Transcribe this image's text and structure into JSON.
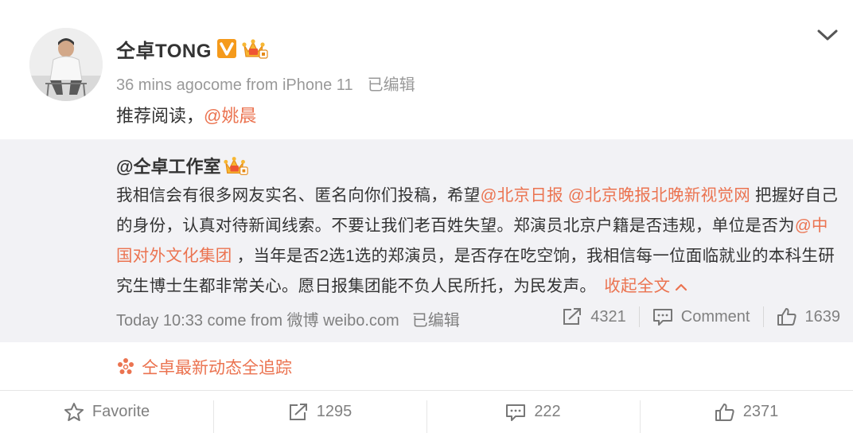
{
  "post": {
    "username": "仝卓TONG",
    "meta": {
      "time_source": "36 mins agocome from iPhone 11",
      "edited": "已编辑"
    },
    "text_prefix": "推荐阅读，",
    "text_mention": "@姚晨"
  },
  "repost": {
    "author": "@仝卓工作室",
    "body": [
      {
        "text": "我相信会有很多网友实名、匿名向你们投稿，希望",
        "link": false
      },
      {
        "text": "@北京日报",
        "link": true
      },
      {
        "text": " ",
        "link": false
      },
      {
        "text": "@北京晚报北晚新视觉网",
        "link": true
      },
      {
        "text": " 把握好自己的身份，认真对待新闻线索。不要让我们老百姓失望。郑演员北京户籍是否违规，单位是否为",
        "link": false
      },
      {
        "text": "@中国对外文化集团",
        "link": true
      },
      {
        "text": " ，当年是否2选1选的郑演员，是否存在吃空饷，我相信每一位面临就业的本科生研究生博士生都非常关心。愿日报集团能不负人民所托，为民发声。",
        "link": false
      }
    ],
    "collapse_label": "收起全文",
    "meta": {
      "time_source": "Today 10:33 come from 微博 weibo.com",
      "edited": "已编辑"
    },
    "actions": {
      "repost_count": "4321",
      "comment_label": "Comment",
      "like_count": "1639"
    }
  },
  "tracker_label": "仝卓最新动态全追踪",
  "bottom_bar": {
    "favorite_label": "Favorite",
    "repost_count": "1295",
    "comment_count": "222",
    "like_count": "2371"
  },
  "colors": {
    "accent": "#eb7350",
    "muted": "#808080",
    "repost_bg": "#f2f2f5",
    "vip_badge": "#f59a1b"
  },
  "icons": [
    "avatar",
    "verified-v-icon",
    "vip-crown-icon",
    "chevron-down-icon",
    "repost-icon",
    "comment-icon",
    "like-icon",
    "tracker-flower-icon",
    "favorite-star-icon"
  ]
}
